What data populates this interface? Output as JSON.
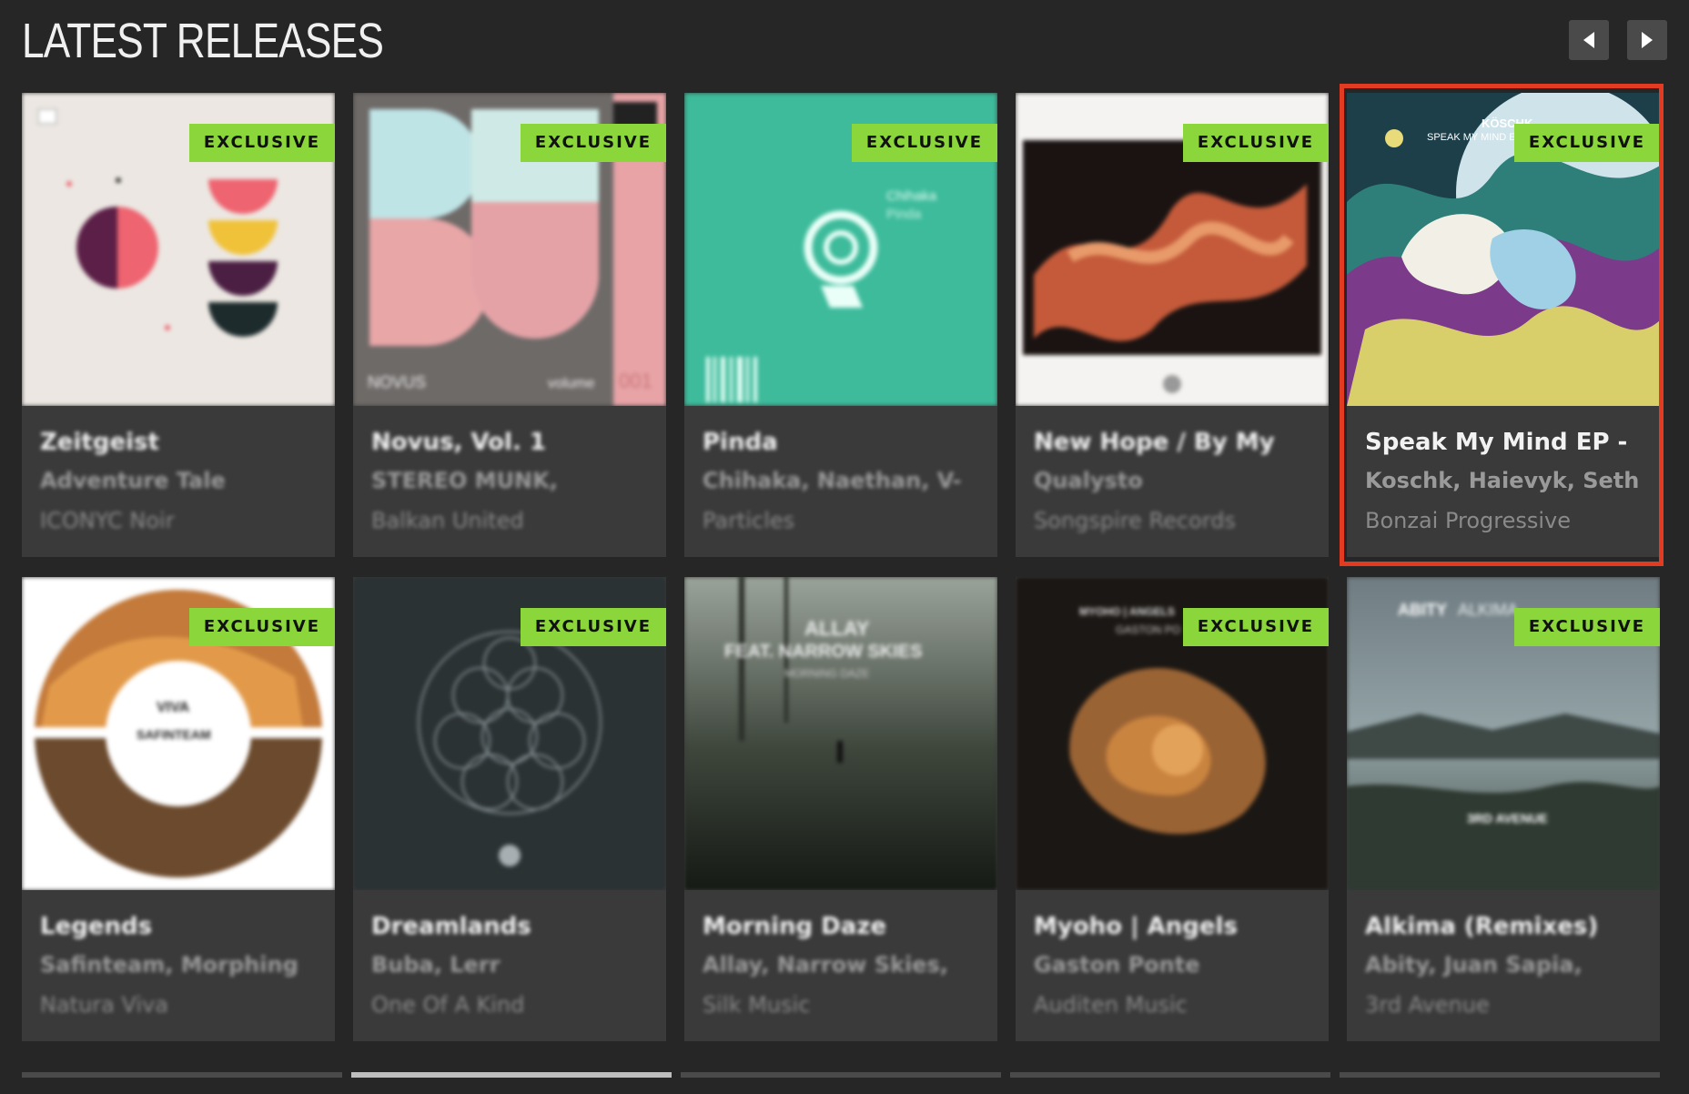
{
  "header": {
    "title": "LATEST RELEASES"
  },
  "nav": {
    "prev": "previous-arrow",
    "next": "next-arrow"
  },
  "badge_label": "EXCLUSIVE",
  "releases": [
    {
      "title": "Zeitgeist",
      "artists": "Adventure Tale",
      "label": "ICONYC Noir"
    },
    {
      "title": "Novus, Vol. 1",
      "artists": "STEREO MUNK,",
      "label": "Balkan United",
      "art_text": [
        "NOVUS",
        "volume",
        "001"
      ]
    },
    {
      "title": "Pinda",
      "artists": "Chihaka, Naethan, V-",
      "label": "Particles",
      "art_text": [
        "Chihaka",
        "Pinda"
      ]
    },
    {
      "title": "New Hope / By My",
      "artists": "Qualysto",
      "label": "Songspire Records"
    },
    {
      "title": "Speak My Mind EP -",
      "artists": "Koschk, Haievyk, Seth",
      "label": "Bonzai Progressive",
      "art_text": [
        "KÖSCHK",
        "SPEAK MY MIND EP"
      ]
    },
    {
      "title": "Legends",
      "artists": "Safinteam, Morphing",
      "label": "Natura Viva",
      "art_text": [
        "VIVA",
        "SAFINTEAM"
      ]
    },
    {
      "title": "Dreamlands",
      "artists": "Buba, Lerr",
      "label": "One Of A Kind"
    },
    {
      "title": "Morning Daze",
      "artists": "Allay, Narrow Skies,",
      "label": "Silk Music",
      "art_text": [
        "ALLAY",
        "FEAT. NARROW SKIES",
        "MORNING DAZE"
      ]
    },
    {
      "title": "Myoho | Angels",
      "artists": "Gaston Ponte",
      "label": "Auditen Music",
      "art_text": [
        "MYOHO | ANGELS",
        "GASTON PO"
      ]
    },
    {
      "title": "Alkima (Remixes)",
      "artists": "Abity, Juan Sapia,",
      "label": "3rd Avenue",
      "art_text": [
        "ABITY",
        "ALKIMA",
        "3RD AVENUE"
      ]
    }
  ],
  "pager": {
    "segments": 5,
    "active": 2
  },
  "colors": {
    "accent": "#8bd63a",
    "highlight": "#e23b21",
    "background": "#262626",
    "card": "#3a3a3a"
  }
}
